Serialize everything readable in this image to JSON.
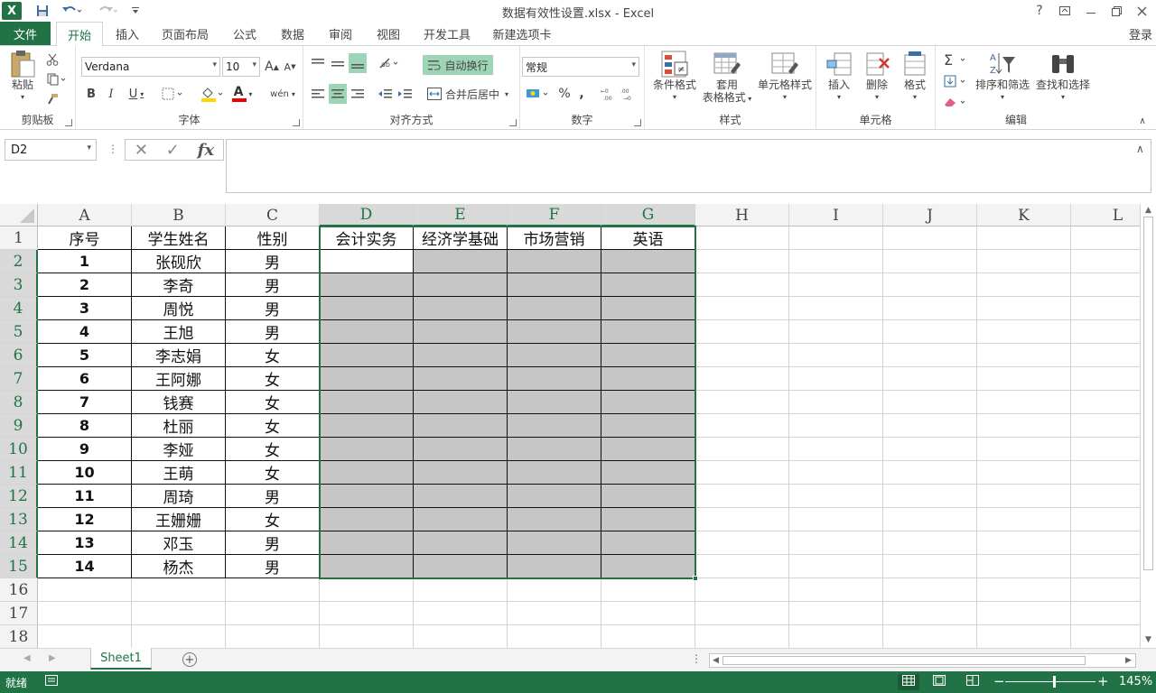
{
  "app": {
    "title": "数据有效性设置.xlsx - Excel",
    "login": "登录",
    "logo": "X",
    "help": "?"
  },
  "tabs": [
    "文件",
    "开始",
    "插入",
    "页面布局",
    "公式",
    "数据",
    "审阅",
    "视图",
    "开发工具",
    "新建选项卡"
  ],
  "ribbon": {
    "clipboard": {
      "paste": "粘贴",
      "label": "剪贴板"
    },
    "font": {
      "name": "Verdana",
      "size": "10",
      "label": "字体",
      "bold": "B",
      "italic": "I",
      "underline": "U",
      "grow": "A",
      "shrink": "A",
      "color_a": "A",
      "phonetic": "wén"
    },
    "align": {
      "wrap": "自动换行",
      "merge": "合并后居中",
      "label": "对齐方式"
    },
    "number": {
      "format": "常规",
      "percent": "%",
      "comma": ",",
      "label": "数字"
    },
    "styles": {
      "cond": "条件格式",
      "table1": "套用",
      "table2": "表格格式",
      "cell": "单元格样式",
      "label": "样式"
    },
    "cells": {
      "insert": "插入",
      "delete": "删除",
      "format": "格式",
      "label": "单元格"
    },
    "editing": {
      "sort": "排序和筛选",
      "find": "查找和选择",
      "label": "编辑"
    }
  },
  "formula": {
    "namebox": "D2",
    "content": "",
    "fx": "fx"
  },
  "columns": [
    "A",
    "B",
    "C",
    "D",
    "E",
    "F",
    "G",
    "H",
    "I",
    "J",
    "K",
    "L"
  ],
  "rows": [
    "1",
    "2",
    "3",
    "4",
    "5",
    "6",
    "7",
    "8",
    "9",
    "10",
    "11",
    "12",
    "13",
    "14",
    "15",
    "16",
    "17",
    "18"
  ],
  "headers": [
    "序号",
    "学生姓名",
    "性别",
    "会计实务",
    "经济学基础",
    "市场营销",
    "英语"
  ],
  "students": [
    {
      "no": "1",
      "name": "张砚欣",
      "gender": "男"
    },
    {
      "no": "2",
      "name": "李奇",
      "gender": "男"
    },
    {
      "no": "3",
      "name": "周悦",
      "gender": "男"
    },
    {
      "no": "4",
      "name": "王旭",
      "gender": "男"
    },
    {
      "no": "5",
      "name": "李志娟",
      "gender": "女"
    },
    {
      "no": "6",
      "name": "王阿娜",
      "gender": "女"
    },
    {
      "no": "7",
      "name": "钱赛",
      "gender": "女"
    },
    {
      "no": "8",
      "name": "杜丽",
      "gender": "女"
    },
    {
      "no": "9",
      "name": "李娅",
      "gender": "女"
    },
    {
      "no": "10",
      "name": "王萌",
      "gender": "女"
    },
    {
      "no": "11",
      "name": "周琦",
      "gender": "男"
    },
    {
      "no": "12",
      "name": "王姗姗",
      "gender": "女"
    },
    {
      "no": "13",
      "name": "邓玉",
      "gender": "男"
    },
    {
      "no": "14",
      "name": "杨杰",
      "gender": "男"
    }
  ],
  "sheets": {
    "active": "Sheet1",
    "add": "+"
  },
  "status": {
    "ready": "就绪",
    "zoom": "145%"
  },
  "colors": {
    "accent": "#217346",
    "selection": "#c6c6c6"
  }
}
